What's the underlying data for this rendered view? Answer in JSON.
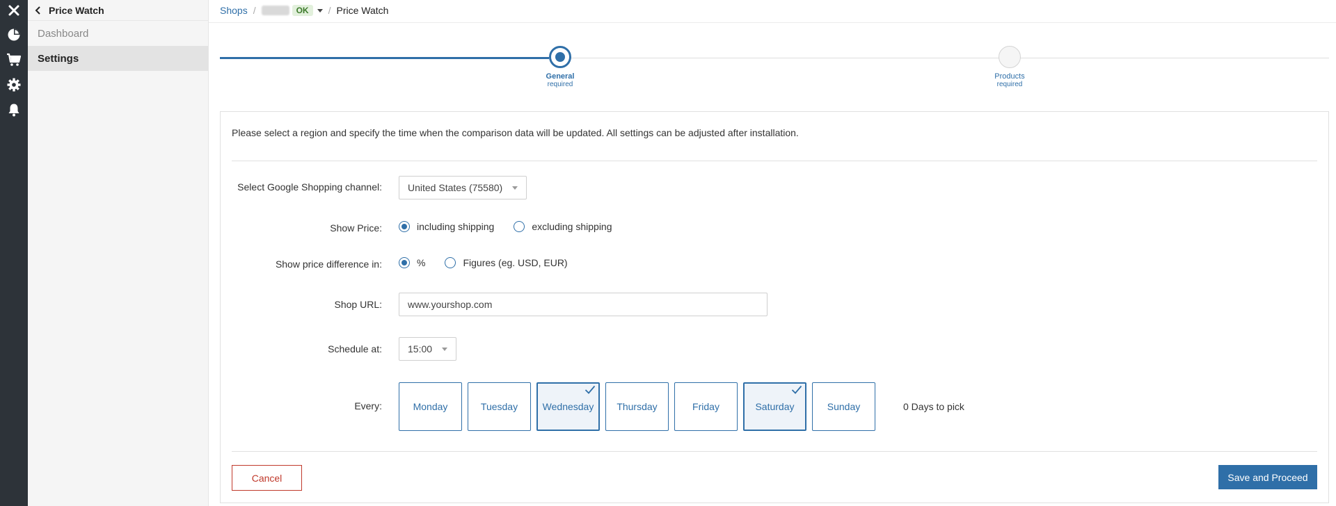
{
  "colors": {
    "accent": "#2f6fa8",
    "danger": "#c0392b",
    "rail": "#2d3339"
  },
  "rail": {
    "icons": [
      "close-icon",
      "chart-pie-icon",
      "cart-icon",
      "gear-icon",
      "bell-icon"
    ]
  },
  "sidebar": {
    "back_label": "Price Watch",
    "items": [
      {
        "label": "Dashboard",
        "active": false
      },
      {
        "label": "Settings",
        "active": true
      }
    ]
  },
  "breadcrumb": {
    "shops": "Shops",
    "status": "OK",
    "current": "Price Watch"
  },
  "stepper": {
    "steps": [
      {
        "label": "General",
        "sub": "required",
        "state": "active"
      },
      {
        "label": "Products",
        "sub": "required",
        "state": "todo"
      }
    ]
  },
  "form": {
    "intro": "Please select a region and specify the time when the comparison data will be updated. All settings can be adjusted after installation.",
    "channel": {
      "label": "Select Google Shopping channel:",
      "value": "United States (75580)"
    },
    "show_price": {
      "label": "Show Price:",
      "options": [
        {
          "label": "including shipping",
          "selected": true
        },
        {
          "label": "excluding shipping",
          "selected": false
        }
      ]
    },
    "price_diff": {
      "label": "Show price difference in:",
      "options": [
        {
          "label": "%",
          "selected": true
        },
        {
          "label": "Figures (eg. USD, EUR)",
          "selected": false
        }
      ]
    },
    "shop_url": {
      "label": "Shop URL:",
      "value": "www.yourshop.com"
    },
    "schedule": {
      "label": "Schedule at:",
      "value": "15:00"
    },
    "every": {
      "label": "Every:",
      "days": [
        {
          "label": "Monday",
          "selected": false
        },
        {
          "label": "Tuesday",
          "selected": false
        },
        {
          "label": "Wednesday",
          "selected": true
        },
        {
          "label": "Thursday",
          "selected": false
        },
        {
          "label": "Friday",
          "selected": false
        },
        {
          "label": "Saturday",
          "selected": true
        },
        {
          "label": "Sunday",
          "selected": false
        }
      ],
      "note": "0 Days to pick"
    }
  },
  "actions": {
    "cancel": "Cancel",
    "save": "Save and Proceed"
  }
}
